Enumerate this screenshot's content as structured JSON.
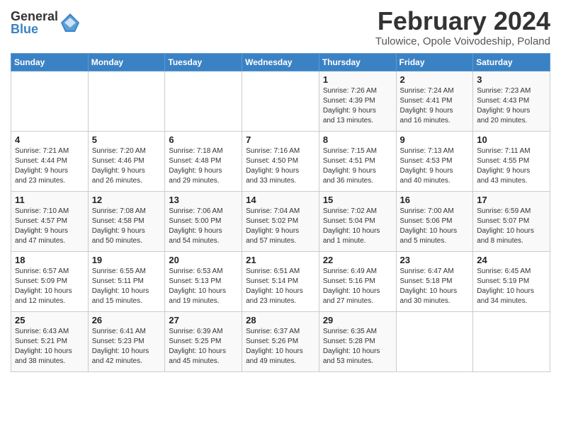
{
  "logo": {
    "general": "General",
    "blue": "Blue"
  },
  "title": "February 2024",
  "subtitle": "Tulowice, Opole Voivodeship, Poland",
  "days_header": [
    "Sunday",
    "Monday",
    "Tuesday",
    "Wednesday",
    "Thursday",
    "Friday",
    "Saturday"
  ],
  "weeks": [
    [
      {
        "day": "",
        "detail": ""
      },
      {
        "day": "",
        "detail": ""
      },
      {
        "day": "",
        "detail": ""
      },
      {
        "day": "",
        "detail": ""
      },
      {
        "day": "1",
        "detail": "Sunrise: 7:26 AM\nSunset: 4:39 PM\nDaylight: 9 hours\nand 13 minutes."
      },
      {
        "day": "2",
        "detail": "Sunrise: 7:24 AM\nSunset: 4:41 PM\nDaylight: 9 hours\nand 16 minutes."
      },
      {
        "day": "3",
        "detail": "Sunrise: 7:23 AM\nSunset: 4:43 PM\nDaylight: 9 hours\nand 20 minutes."
      }
    ],
    [
      {
        "day": "4",
        "detail": "Sunrise: 7:21 AM\nSunset: 4:44 PM\nDaylight: 9 hours\nand 23 minutes."
      },
      {
        "day": "5",
        "detail": "Sunrise: 7:20 AM\nSunset: 4:46 PM\nDaylight: 9 hours\nand 26 minutes."
      },
      {
        "day": "6",
        "detail": "Sunrise: 7:18 AM\nSunset: 4:48 PM\nDaylight: 9 hours\nand 29 minutes."
      },
      {
        "day": "7",
        "detail": "Sunrise: 7:16 AM\nSunset: 4:50 PM\nDaylight: 9 hours\nand 33 minutes."
      },
      {
        "day": "8",
        "detail": "Sunrise: 7:15 AM\nSunset: 4:51 PM\nDaylight: 9 hours\nand 36 minutes."
      },
      {
        "day": "9",
        "detail": "Sunrise: 7:13 AM\nSunset: 4:53 PM\nDaylight: 9 hours\nand 40 minutes."
      },
      {
        "day": "10",
        "detail": "Sunrise: 7:11 AM\nSunset: 4:55 PM\nDaylight: 9 hours\nand 43 minutes."
      }
    ],
    [
      {
        "day": "11",
        "detail": "Sunrise: 7:10 AM\nSunset: 4:57 PM\nDaylight: 9 hours\nand 47 minutes."
      },
      {
        "day": "12",
        "detail": "Sunrise: 7:08 AM\nSunset: 4:58 PM\nDaylight: 9 hours\nand 50 minutes."
      },
      {
        "day": "13",
        "detail": "Sunrise: 7:06 AM\nSunset: 5:00 PM\nDaylight: 9 hours\nand 54 minutes."
      },
      {
        "day": "14",
        "detail": "Sunrise: 7:04 AM\nSunset: 5:02 PM\nDaylight: 9 hours\nand 57 minutes."
      },
      {
        "day": "15",
        "detail": "Sunrise: 7:02 AM\nSunset: 5:04 PM\nDaylight: 10 hours\nand 1 minute."
      },
      {
        "day": "16",
        "detail": "Sunrise: 7:00 AM\nSunset: 5:06 PM\nDaylight: 10 hours\nand 5 minutes."
      },
      {
        "day": "17",
        "detail": "Sunrise: 6:59 AM\nSunset: 5:07 PM\nDaylight: 10 hours\nand 8 minutes."
      }
    ],
    [
      {
        "day": "18",
        "detail": "Sunrise: 6:57 AM\nSunset: 5:09 PM\nDaylight: 10 hours\nand 12 minutes."
      },
      {
        "day": "19",
        "detail": "Sunrise: 6:55 AM\nSunset: 5:11 PM\nDaylight: 10 hours\nand 15 minutes."
      },
      {
        "day": "20",
        "detail": "Sunrise: 6:53 AM\nSunset: 5:13 PM\nDaylight: 10 hours\nand 19 minutes."
      },
      {
        "day": "21",
        "detail": "Sunrise: 6:51 AM\nSunset: 5:14 PM\nDaylight: 10 hours\nand 23 minutes."
      },
      {
        "day": "22",
        "detail": "Sunrise: 6:49 AM\nSunset: 5:16 PM\nDaylight: 10 hours\nand 27 minutes."
      },
      {
        "day": "23",
        "detail": "Sunrise: 6:47 AM\nSunset: 5:18 PM\nDaylight: 10 hours\nand 30 minutes."
      },
      {
        "day": "24",
        "detail": "Sunrise: 6:45 AM\nSunset: 5:19 PM\nDaylight: 10 hours\nand 34 minutes."
      }
    ],
    [
      {
        "day": "25",
        "detail": "Sunrise: 6:43 AM\nSunset: 5:21 PM\nDaylight: 10 hours\nand 38 minutes."
      },
      {
        "day": "26",
        "detail": "Sunrise: 6:41 AM\nSunset: 5:23 PM\nDaylight: 10 hours\nand 42 minutes."
      },
      {
        "day": "27",
        "detail": "Sunrise: 6:39 AM\nSunset: 5:25 PM\nDaylight: 10 hours\nand 45 minutes."
      },
      {
        "day": "28",
        "detail": "Sunrise: 6:37 AM\nSunset: 5:26 PM\nDaylight: 10 hours\nand 49 minutes."
      },
      {
        "day": "29",
        "detail": "Sunrise: 6:35 AM\nSunset: 5:28 PM\nDaylight: 10 hours\nand 53 minutes."
      },
      {
        "day": "",
        "detail": ""
      },
      {
        "day": "",
        "detail": ""
      }
    ]
  ]
}
